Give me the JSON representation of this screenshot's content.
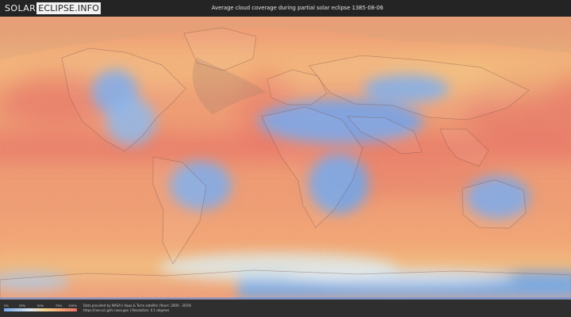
{
  "site": {
    "logo_left": "SOLAR",
    "logo_right": "ECLIPSE.INFO"
  },
  "title": "Average cloud coverage during partial solar eclipse 1385-08-06",
  "legend": {
    "ticks": [
      "0%",
      "25%",
      "50%",
      "75%",
      "100%"
    ],
    "gradient_colors": [
      "#75a9ef",
      "#a8c6ec",
      "#d8e5ef",
      "#f4d38f",
      "#f4ad78",
      "#e76f68"
    ]
  },
  "source": {
    "line1": "Data provided by NASA's Aqua & Terra satellite (Years: 2000 - 2019)",
    "line2": "https://neo.sci.gsfc.nasa.gov | Resolution: 0.1 degrees"
  },
  "map": {
    "colors": {
      "cloud_high": "#e76f68",
      "cloud_medium": "#f4ad78",
      "cloud_low": "#f4d38f",
      "clear": "#75a9ef",
      "shadow_overlay": "#b0846f"
    },
    "icons": [
      "logo-mark",
      "colorbar"
    ]
  }
}
